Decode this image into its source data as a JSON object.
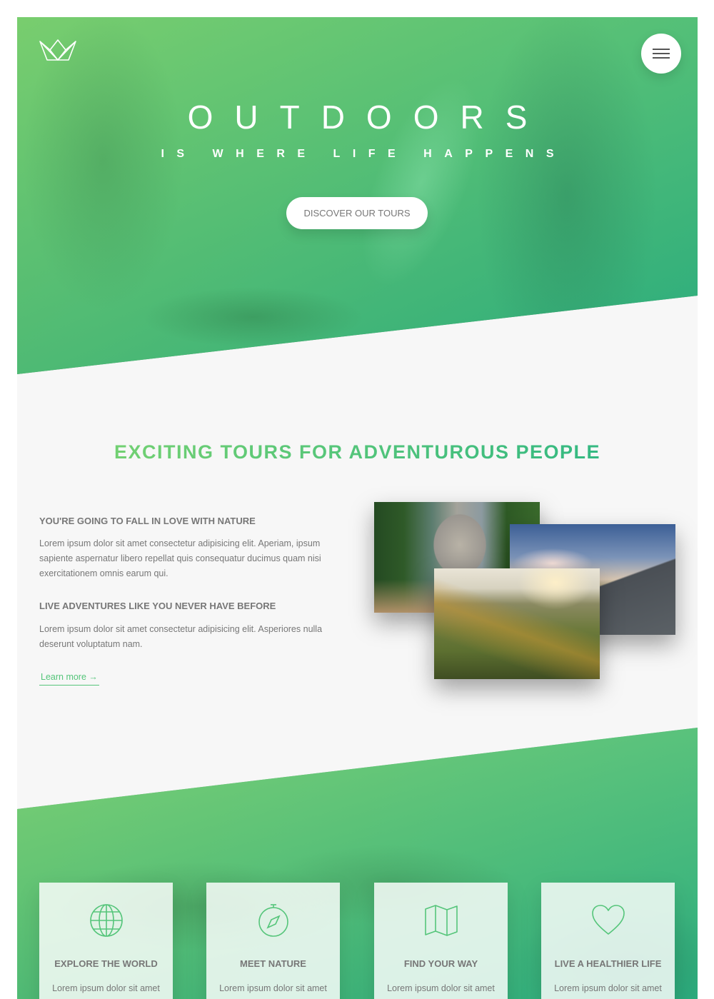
{
  "hero": {
    "title": "OUTDOORS",
    "subtitle": "IS WHERE LIFE HAPPENS",
    "cta_label": "DISCOVER OUR TOURS"
  },
  "about": {
    "heading": "EXCITING TOURS FOR ADVENTUROUS PEOPLE",
    "blocks": [
      {
        "title": "YOU'RE GOING TO FALL IN LOVE WITH NATURE",
        "text": "Lorem ipsum dolor sit amet consectetur adipisicing elit. Aperiam, ipsum sapiente aspernatur libero repellat quis consequatur ducimus quam nisi exercitationem omnis earum qui."
      },
      {
        "title": "LIVE ADVENTURES LIKE YOU NEVER HAVE BEFORE",
        "text": "Lorem ipsum dolor sit amet consectetur adipisicing elit. Asperiores nulla deserunt voluptatum nam."
      }
    ],
    "link_label": "Learn more →",
    "photos": [
      "forest-valley-photo",
      "cyclist-road-photo",
      "mountain-ridge-hiker-photo"
    ]
  },
  "features": {
    "cards": [
      {
        "icon": "globe-icon",
        "title": "EXPLORE THE WORLD",
        "text": "Lorem ipsum dolor sit amet"
      },
      {
        "icon": "compass-icon",
        "title": "MEET NATURE",
        "text": "Lorem ipsum dolor sit amet"
      },
      {
        "icon": "map-icon",
        "title": "FIND YOUR WAY",
        "text": "Lorem ipsum dolor sit amet"
      },
      {
        "icon": "heart-icon",
        "title": "LIVE A HEALTHIER LIFE",
        "text": "Lorem ipsum dolor sit amet"
      }
    ]
  },
  "colors": {
    "primary_light": "#7ed56f",
    "primary_dark": "#28b485",
    "primary": "#55c57a",
    "text": "#777777",
    "background": "#f7f7f7"
  }
}
